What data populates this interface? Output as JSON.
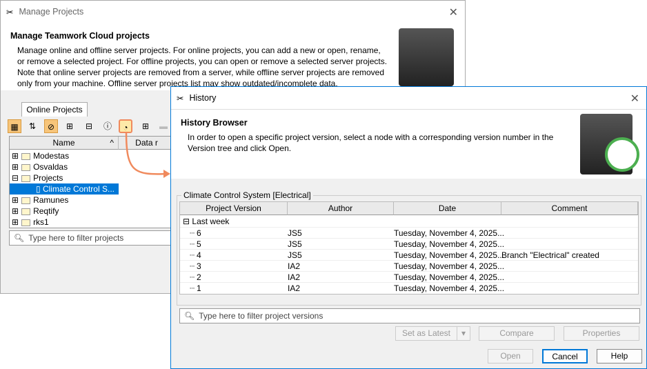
{
  "manage": {
    "title": "Manage Projects",
    "heading": "Manage Teamwork Cloud projects",
    "desc": "Manage online and offline server projects. For online projects, you can add a new or open, rename, or remove a selected project. For offline projects, you can open or remove a selected server projects. Note that online server projects are removed from a server, while offline server projects are removed only from your machine. Offline server projects list may show outdated/incomplete data.",
    "tab": "Online Projects",
    "col_name": "Name",
    "col_data": "Data r",
    "items": [
      {
        "label": "Modestas",
        "type": "folder"
      },
      {
        "label": "Osvaldas",
        "type": "folder"
      },
      {
        "label": "Projects",
        "type": "folder"
      },
      {
        "label": "Climate Control S...",
        "type": "project"
      },
      {
        "label": "Ramunes",
        "type": "folder"
      },
      {
        "label": "Reqtify",
        "type": "folder"
      },
      {
        "label": "rks1",
        "type": "folder"
      }
    ],
    "filter_placeholder": "Type here to filter projects"
  },
  "history": {
    "title": "History",
    "heading": "History Browser",
    "desc": "In order to open a specific project version, select a node with a corresponding version number in the Version tree and click Open.",
    "group": "Climate Control System [Electrical]",
    "columns": [
      "Project Version",
      "Author",
      "Date",
      "Comment"
    ],
    "group_row": "Last week",
    "rows": [
      {
        "v": "6",
        "a": "JS5",
        "d": "Tuesday, November 4, 2025...",
        "c": ""
      },
      {
        "v": "5",
        "a": "JS5",
        "d": "Tuesday, November 4, 2025...",
        "c": ""
      },
      {
        "v": "4",
        "a": "JS5",
        "d": "Tuesday, November 4, 2025...",
        "c": "Branch \"Electrical\" created"
      },
      {
        "v": "3",
        "a": "IA2",
        "d": "Tuesday, November 4, 2025...",
        "c": ""
      },
      {
        "v": "2",
        "a": "IA2",
        "d": "Tuesday, November 4, 2025...",
        "c": ""
      },
      {
        "v": "1",
        "a": "IA2",
        "d": "Tuesday, November 4, 2025...",
        "c": ""
      }
    ],
    "filter_placeholder": "Type here to filter project versions",
    "set_latest": "Set as Latest",
    "compare": "Compare",
    "properties": "Properties",
    "open": "Open",
    "cancel": "Cancel",
    "help": "Help"
  },
  "colors": {
    "accent": "#0078d7",
    "highlight": "#f08a5d"
  }
}
